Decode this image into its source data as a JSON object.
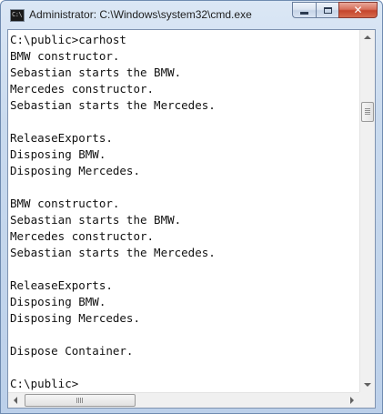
{
  "window": {
    "title": "Administrator: C:\\Windows\\system32\\cmd.exe",
    "icon": "cmd-icon",
    "icon_text": "C:\\",
    "close_glyph": "✕"
  },
  "console": {
    "lines": [
      "C:\\public>carhost",
      "BMW constructor.",
      "Sebastian starts the BMW.",
      "Mercedes constructor.",
      "Sebastian starts the Mercedes.",
      "",
      "ReleaseExports.",
      "Disposing BMW.",
      "Disposing Mercedes.",
      "",
      "BMW constructor.",
      "Sebastian starts the BMW.",
      "Mercedes constructor.",
      "Sebastian starts the Mercedes.",
      "",
      "ReleaseExports.",
      "Disposing BMW.",
      "Disposing Mercedes.",
      "",
      "Dispose Container.",
      "",
      "C:\\public>"
    ]
  },
  "scrollbars": {
    "vertical_position": 0.2,
    "horizontal_position": 0.0
  },
  "colors": {
    "console_background": "#ffffff",
    "console_text": "#111111",
    "close_button": "#c5452c"
  }
}
